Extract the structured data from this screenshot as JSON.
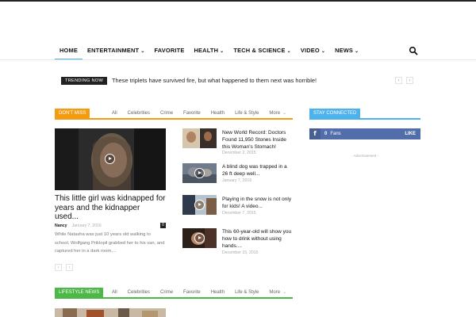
{
  "nav": {
    "items": [
      {
        "label": "HOME",
        "dropdown": false,
        "active": true
      },
      {
        "label": "ENTERTAINMENT",
        "dropdown": true,
        "active": false
      },
      {
        "label": "FAVORITE",
        "dropdown": false,
        "active": false
      },
      {
        "label": "HEALTH",
        "dropdown": true,
        "active": false
      },
      {
        "label": "TECH & SCIENCE",
        "dropdown": true,
        "active": false
      },
      {
        "label": "VIDEO",
        "dropdown": true,
        "active": false
      },
      {
        "label": "NEWS",
        "dropdown": true,
        "active": false
      }
    ],
    "search_icon": "search-icon",
    "accent_color": "#4db2ec"
  },
  "trending": {
    "label": "TRENDING NOW",
    "text": "These triplets have survived fire, but what happened to them next was horrible!",
    "prev_icon": "‹",
    "next_icon": "›"
  },
  "dont_miss": {
    "title": "DON'T MISS",
    "color": "#f39c12",
    "tabs": [
      "All",
      "Celebrities",
      "Crime",
      "Favorite",
      "Health",
      "Life & Style",
      "More"
    ],
    "big_post": {
      "title": "This little girl was kidnapped for years and the kidnapper used...",
      "author": "Nancy",
      "date": "January 7, 2016",
      "comments": "0",
      "excerpt": "While Natasha was just 10 years old walking to school, Wolfgang Priklopil grabbed her to his van, and captured her in a dark room,..."
    },
    "small_posts": [
      {
        "title": "New World Record: Doctors Found 11,950 Stones Inside this Woman's Stomach!",
        "date": "December 2, 2015"
      },
      {
        "title": "A blind dog was trapped in a 26 ft deep well...",
        "date": "January 7, 2016"
      },
      {
        "title": "Playing in the snow is not only for kids! A video...",
        "date": "December 7, 2015"
      },
      {
        "title": "This 60-year-old will show you how to drink without using hands....",
        "date": "December 15, 2015"
      }
    ]
  },
  "sidebar": {
    "stay_connected": "STAY CONNECTED",
    "color": "#4db2ec",
    "facebook": {
      "icon": "f",
      "count": "0",
      "label": "Fans",
      "action": "LIKE",
      "color": "#516eab"
    },
    "advertisement": "- Advertisement -"
  },
  "lifestyle": {
    "title": "LIFESTYLE NEWS",
    "color": "#4db748",
    "tabs": [
      "All",
      "Celebrities",
      "Crime",
      "Favorite",
      "Health",
      "Life & Style",
      "More"
    ]
  },
  "pager": {
    "prev": "‹",
    "next": "›"
  }
}
